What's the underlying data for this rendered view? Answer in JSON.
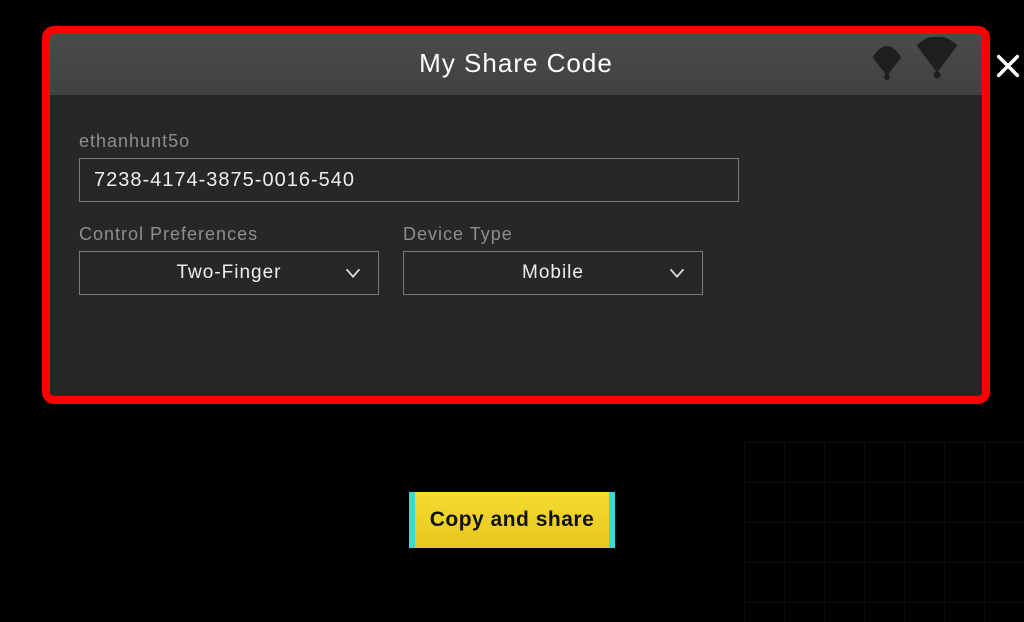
{
  "dialog": {
    "title": "My Share Code",
    "username": "ethanhunt5o",
    "share_code": "7238-4174-3875-0016-540",
    "fields": {
      "control_prefs": {
        "label": "Control Preferences",
        "value": "Two-Finger"
      },
      "device_type": {
        "label": "Device Type",
        "value": "Mobile"
      }
    }
  },
  "actions": {
    "copy_share": "Copy and share"
  }
}
